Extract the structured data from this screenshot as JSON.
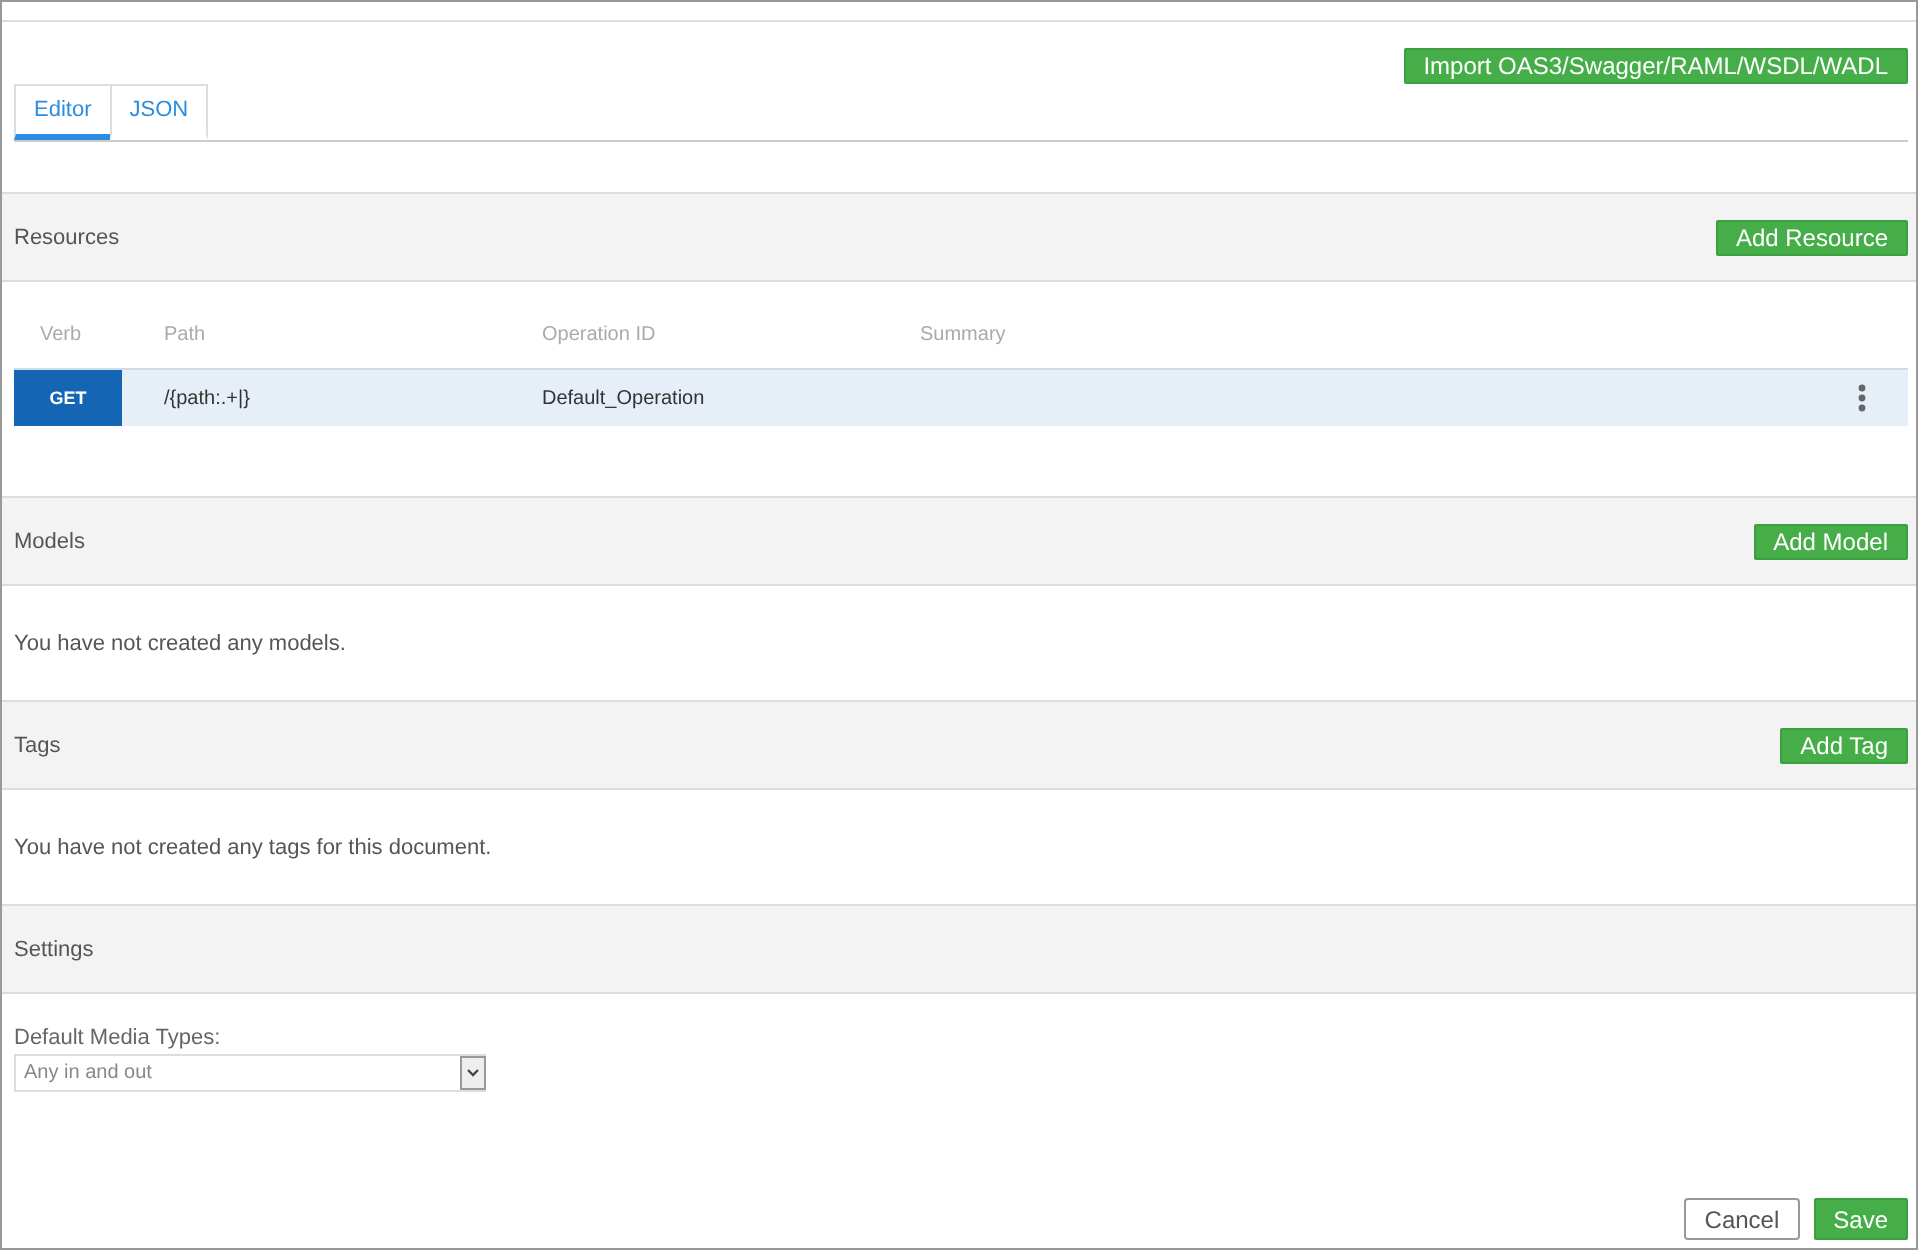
{
  "import_button": "Import OAS3/Swagger/RAML/WSDL/WADL",
  "tabs": [
    {
      "label": "Editor",
      "selected": true
    },
    {
      "label": "JSON",
      "selected": false
    }
  ],
  "resources": {
    "title": "Resources",
    "button": "Add Resource",
    "columns": [
      "Verb",
      "Path",
      "Operation ID",
      "Summary"
    ],
    "rows": [
      {
        "verb": "GET",
        "path": "/{path:.+|}",
        "operation_id": "Default_Operation",
        "selected": true
      }
    ]
  },
  "models": {
    "title": "Models",
    "button": "Add Model",
    "empty_text": "You have not created any models."
  },
  "tags": {
    "title": "Tags",
    "button": "Add Tag",
    "empty_text": "You have not created any tags for this document."
  },
  "settings": {
    "title": "Settings",
    "media_types_label": "Default Media Types:",
    "media_types_value": "Any in and out"
  },
  "footer_buttons": [
    {
      "label": "Cancel",
      "kind": "secondary"
    },
    {
      "label": "Save",
      "kind": "primary"
    }
  ]
}
